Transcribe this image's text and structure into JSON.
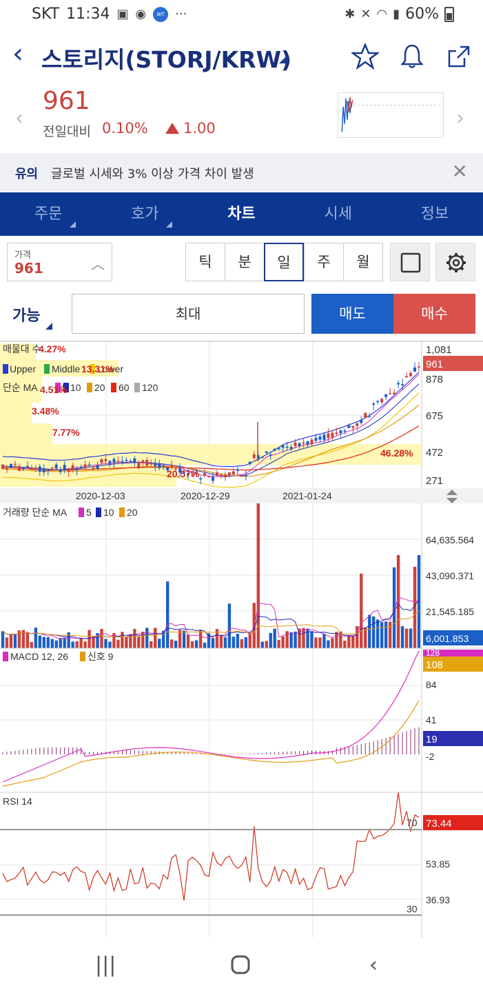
{
  "status": {
    "carrier": "SKT",
    "time": "11:34",
    "battery": "60%",
    "badge": "BIT"
  },
  "header": {
    "title": "스토리지(STORJ/KRW)"
  },
  "quote": {
    "price": "961",
    "change_label": "전일대비",
    "change_pct": "0.10%",
    "change_abs": "1.00"
  },
  "notice": {
    "tag": "유의",
    "message": "글로벌 시세와 3% 이상 가격 차이 발생"
  },
  "tabs": [
    {
      "label": "주문"
    },
    {
      "label": "호가"
    },
    {
      "label": "차트"
    },
    {
      "label": "시세"
    },
    {
      "label": "정보"
    }
  ],
  "toolbar": {
    "price_label": "가격",
    "price_value": "961",
    "periods": [
      "틱",
      "분",
      "일",
      "주",
      "월"
    ]
  },
  "order": {
    "available_label": "가능",
    "max_label": "최대",
    "sell_label": "매도",
    "buy_label": "매수"
  },
  "chart": {
    "legends": {
      "volume_profile": "매물대 수",
      "bollinger": [
        "Upper",
        "Middle",
        "Lower"
      ],
      "ma": "단순 MA",
      "ma_periods": [
        "5",
        "10",
        "20",
        "60",
        "120"
      ],
      "volume": "거래량 단순 MA",
      "volume_periods": [
        "5",
        "10",
        "20"
      ],
      "macd": "MACD 12, 26",
      "macd_signal": "신호 9",
      "rsi": "RSI 14"
    },
    "profile_pcts": [
      "4.27%",
      "13.31%",
      "4.51%",
      "3.48%",
      "7.77%",
      "46.28%",
      "20.57%"
    ],
    "price_axis": [
      "1,081",
      "878",
      "675",
      "472",
      "271"
    ],
    "price_current": "961",
    "date_labels": [
      "2020-12-03",
      "2020-12-29",
      "2021-01-24"
    ],
    "volume_axis": [
      "64,635.564",
      "43,090.371",
      "21,545.185"
    ],
    "volume_current": "6,001.853",
    "macd_axis": [
      "84",
      "41",
      "-2"
    ],
    "macd_current": "128",
    "signal_current": "108",
    "hist_current": "19",
    "rsi_axis": [
      "53.85",
      "36.93"
    ],
    "rsi_levels": [
      "70",
      "30"
    ],
    "rsi_current": "73.44",
    "colors": {
      "up": "#c9433c",
      "down": "#1b5fc7",
      "ma5": "#d82cc0",
      "ma10": "#1c2bb0",
      "ma20": "#e39a12",
      "ma60": "#e02a10",
      "ma120": "#aaaaaa"
    }
  }
}
